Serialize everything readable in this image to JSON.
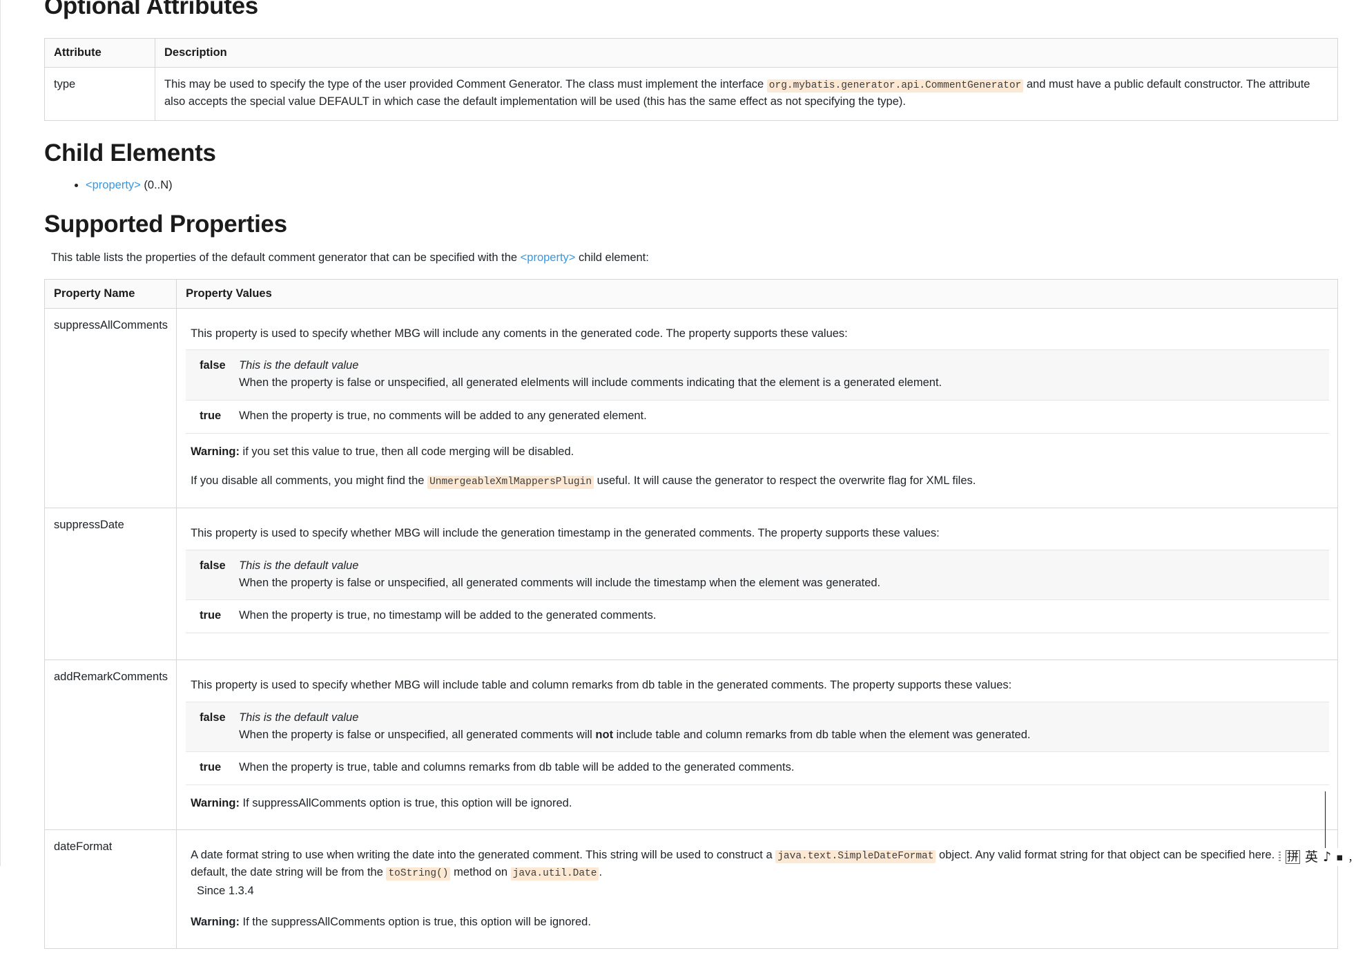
{
  "sections": {
    "optional_attributes_title": "Optional Attributes",
    "child_elements_title": "Child Elements",
    "supported_properties_title": "Supported Properties"
  },
  "attributes_table": {
    "headers": {
      "attribute": "Attribute",
      "description": "Description"
    },
    "rows": [
      {
        "attribute": "type",
        "desc_part1": "This may be used to specify the type of the user provided Comment Generator. The class must implement the interface ",
        "desc_code1": "org.mybatis.generator.api.CommentGenerator",
        "desc_part2": " and must have a public default constructor. The attribute also accepts the special value DEFAULT in which case the default implementation will be used (this has the same effect as not specifying the type)."
      }
    ]
  },
  "child_elements": {
    "items": [
      {
        "link": "<property>",
        "cardinality": " (0..N)"
      }
    ]
  },
  "supported_properties": {
    "intro_part1": "This table lists the properties of the default comment generator that can be specified with the ",
    "intro_link": "<property>",
    "intro_part2": " child element:",
    "headers": {
      "property_name": "Property Name",
      "property_values": "Property Values"
    },
    "rows": [
      {
        "name": "suppressAllComments",
        "lead": "This property is used to specify whether MBG will include any coments in the generated code. The property supports these values:",
        "values": [
          {
            "term": "false",
            "italic": "This is the default value",
            "detail": "When the property is false or unspecified, all generated elelments will include comments indicating that the element is a generated element.",
            "shaded": true
          },
          {
            "term": "true",
            "italic": "",
            "detail": "When the property is true, no comments will be added to any generated element.",
            "shaded": false
          }
        ],
        "notes": [
          {
            "bold": "Warning:",
            "text": " if you set this value to true, then all code merging will be disabled."
          },
          {
            "bold": "",
            "text_before": "If you disable all comments, you might find the ",
            "code": "UnmergeableXmlMappersPlugin",
            "text_after": " useful. It will cause the generator to respect the overwrite flag for XML files."
          }
        ]
      },
      {
        "name": "suppressDate",
        "lead": "This property is used to specify whether MBG will include the generation timestamp in the generated comments. The property supports these values:",
        "values": [
          {
            "term": "false",
            "italic": "This is the default value",
            "detail": "When the property is false or unspecified, all generated comments will include the timestamp when the element was generated.",
            "shaded": true
          },
          {
            "term": "true",
            "italic": "",
            "detail": "When the property is true, no timestamp will be added to the generated comments.",
            "shaded": false
          }
        ],
        "notes": []
      },
      {
        "name": "addRemarkComments",
        "lead": "This property is used to specify whether MBG will include table and column remarks from db table in the generated comments. The property supports these values:",
        "values": [
          {
            "term": "false",
            "italic": "This is the default value",
            "detail_before": "When the property is false or unspecified, all generated comments will ",
            "detail_bold": "not",
            "detail_after": " include table and column remarks from db table when the element was generated.",
            "shaded": true
          },
          {
            "term": "true",
            "italic": "",
            "detail": "When the property is true, table and columns remarks from db table will be added to the generated comments.",
            "shaded": false
          }
        ],
        "notes": [
          {
            "bold": "Warning:",
            "text": " If suppressAllComments option is true, this option will be ignored."
          }
        ]
      },
      {
        "name": "dateFormat",
        "text_1": "A date format string to use when writing the date into the generated comment. This string will be used to construct a ",
        "code_1": "java.text.SimpleDateFormat",
        "text_2": " object. Any valid format string for that object can be specified here. By default, the date string will be from the ",
        "code_2": "toString()",
        "text_3": " method on ",
        "code_3": "java.util.Date",
        "text_4": ".",
        "since": "Since 1.3.4",
        "warning_bold": "Warning:",
        "warning_text": " If the suppressAllComments option is true, this option will be ignored."
      }
    ]
  },
  "ime": {
    "key_glyph": "拼",
    "mode_glyph": "英",
    "tone_glyph": "♪",
    "dot_glyph": "▪",
    "comma_glyph": "，"
  },
  "colors": {
    "link": "#3997e0",
    "code_bg": "#fde9d3",
    "border": "#d6d6d6",
    "header_bg": "#fafafa",
    "shaded_row": "#f7f7f7"
  }
}
